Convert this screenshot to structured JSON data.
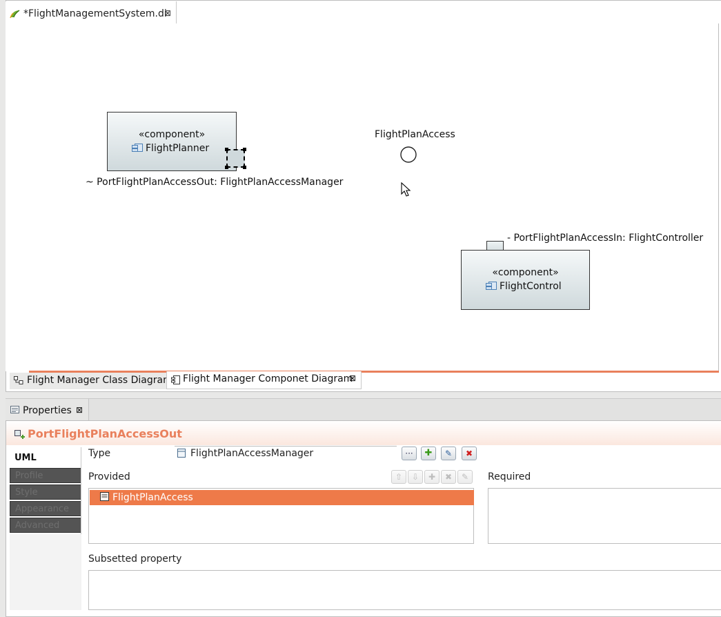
{
  "editor": {
    "tab_title": "*FlightManagementSystem.di",
    "close_glyph": "⊠"
  },
  "diagram": {
    "flight_planner": {
      "stereotype": "«component»",
      "name": "FlightPlanner"
    },
    "flight_control": {
      "stereotype": "«component»",
      "name": "FlightControl"
    },
    "interface_label": "FlightPlanAccess",
    "port_out_label": "~ PortFlightPlanAccessOut: FlightPlanAccessManager",
    "port_in_label": "- PortFlightPlanAccessIn: FlightController"
  },
  "diagram_tabs": [
    {
      "label": "Flight Manager Class Diagram"
    },
    {
      "label": "Flight Manager Componet Diagram"
    }
  ],
  "properties": {
    "tab_label": "Properties",
    "selected_element": "PortFlightPlanAccessOut",
    "side_tabs": [
      "UML",
      "Profile",
      "Style",
      "Appearance",
      "Advanced"
    ],
    "type_label": "Type",
    "type_value": "FlightPlanAccessManager",
    "provided_label": "Provided",
    "provided_items": [
      "FlightPlanAccess"
    ],
    "required_label": "Required",
    "subsetted_label": "Subsetted property",
    "browse_glyph": "···",
    "add_glyph": "✚",
    "edit_glyph": "✎",
    "delete_glyph": "✖",
    "up_glyph": "⇧",
    "down_glyph": "⇩"
  },
  "colors": {
    "accent": "#e9805c",
    "selection": "#ee7a49"
  }
}
